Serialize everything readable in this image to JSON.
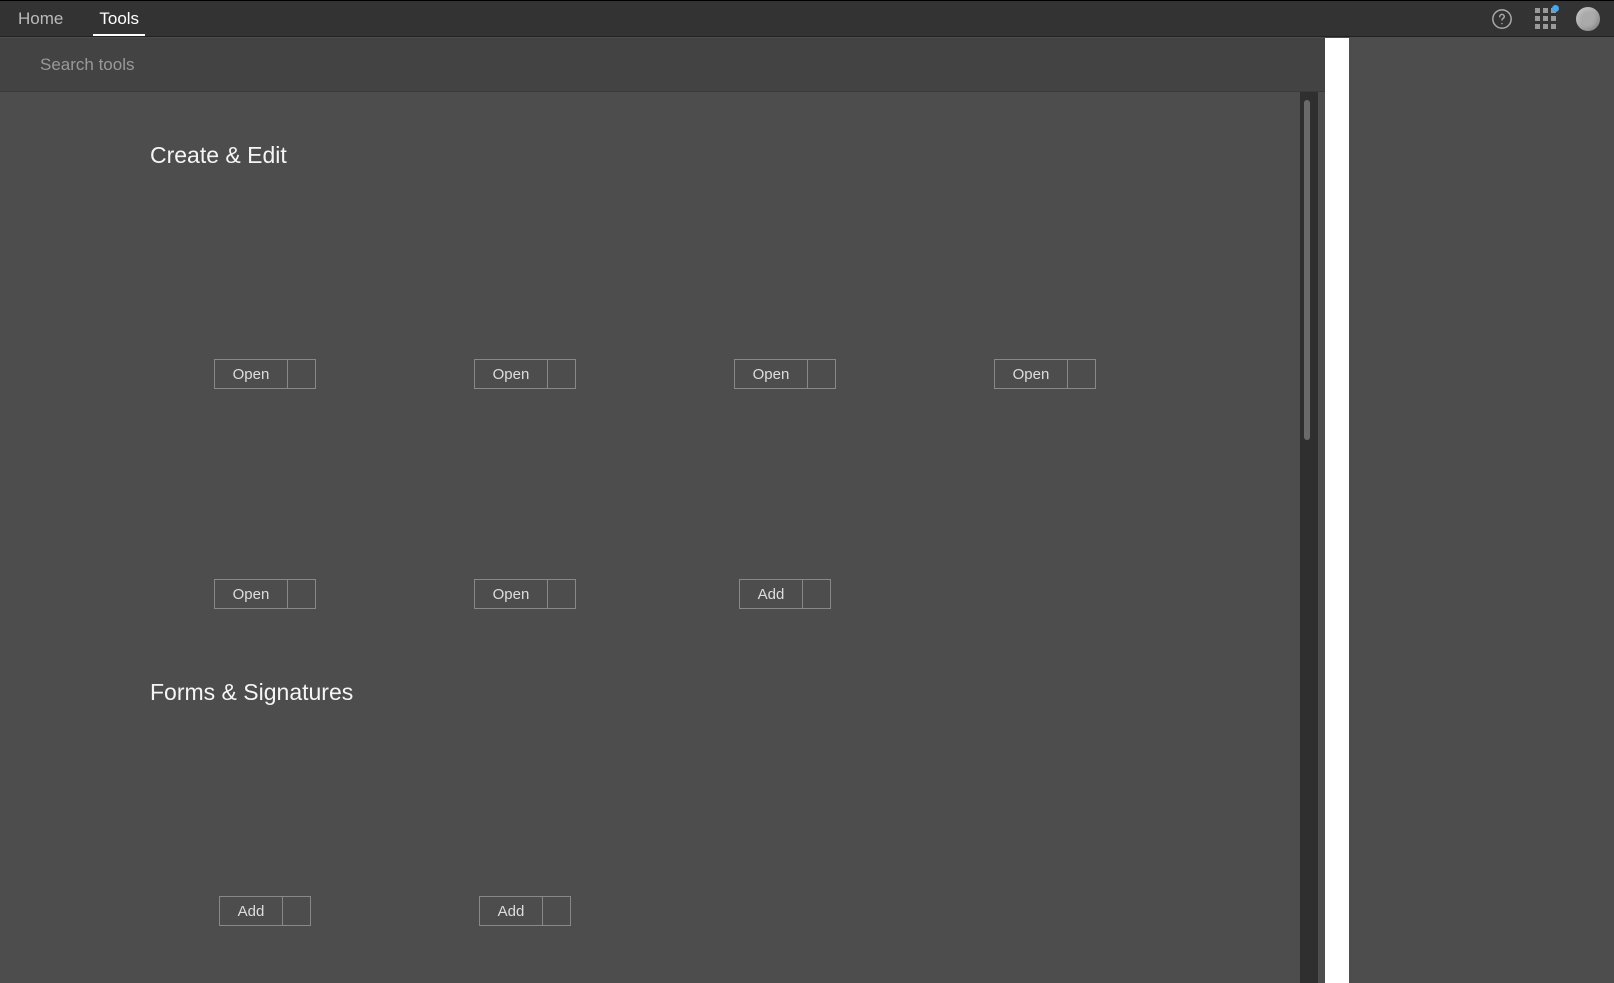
{
  "header": {
    "tabs": [
      {
        "label": "Home",
        "active": false
      },
      {
        "label": "Tools",
        "active": true
      }
    ]
  },
  "search": {
    "placeholder": "Search tools"
  },
  "sections": [
    {
      "title": "Create & Edit",
      "tools": [
        {
          "action": "Open"
        },
        {
          "action": "Open"
        },
        {
          "action": "Open"
        },
        {
          "action": "Open"
        },
        {
          "action": "Open"
        },
        {
          "action": "Open"
        },
        {
          "action": "Add"
        }
      ]
    },
    {
      "title": "Forms & Signatures",
      "tools": [
        {
          "action": "Add"
        },
        {
          "action": "Add"
        }
      ]
    }
  ]
}
